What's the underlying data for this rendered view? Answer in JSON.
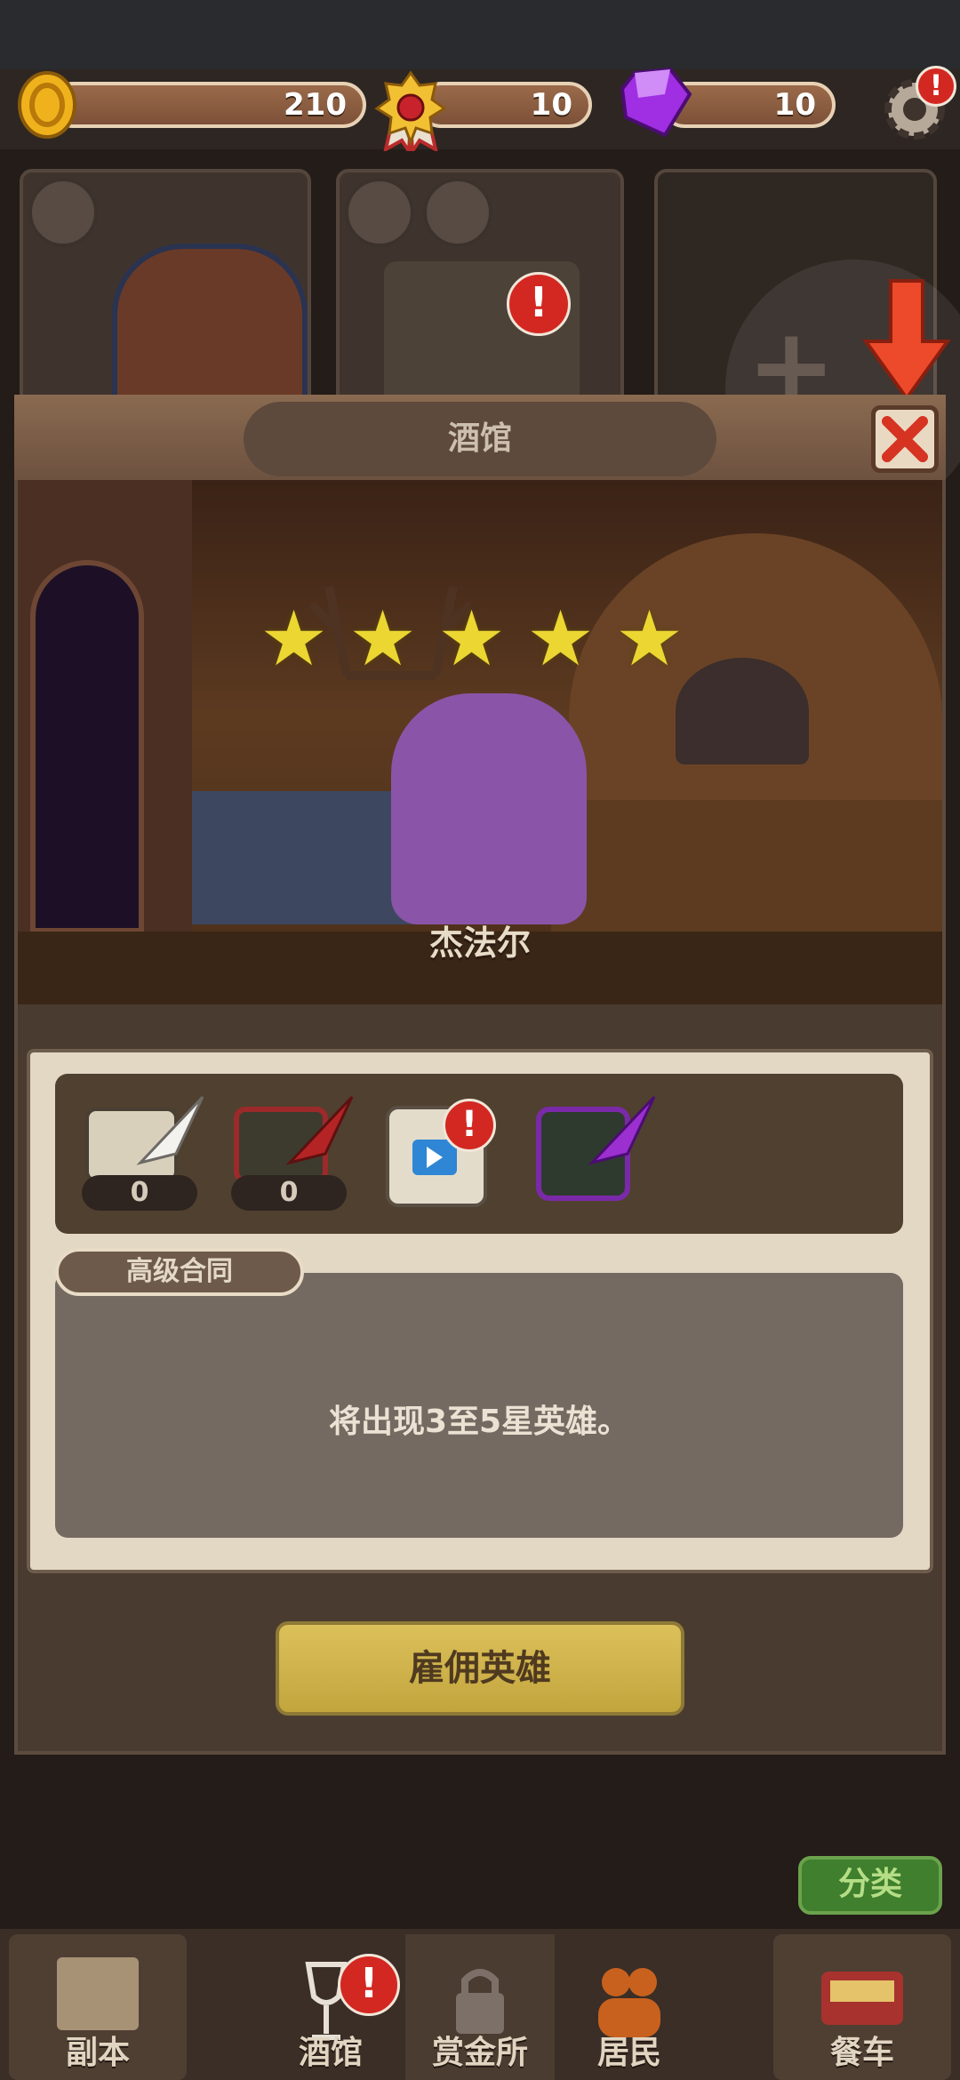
{
  "resources": {
    "gold": "210",
    "medal": "10",
    "gem": "10"
  },
  "dialog": {
    "title": "酒馆",
    "hero_name": "杰法尔",
    "stars": 5
  },
  "scrolls": [
    {
      "name": "white-scroll",
      "count": "0"
    },
    {
      "name": "red-scroll",
      "count": "0"
    },
    {
      "name": "video-scroll",
      "count": ""
    },
    {
      "name": "purple-scroll",
      "count": ""
    }
  ],
  "contract": {
    "tab": "高级合同",
    "description": "将出现3至5星英雄。"
  },
  "hire_button": "雇佣英雄",
  "sort_button": "分类",
  "nav": {
    "dungeon": "副本",
    "tavern": "酒馆",
    "bounty": "赏金所",
    "residents": "居民",
    "food_truck": "餐车"
  },
  "alert_mark": "!",
  "colors": {
    "gold_star": "#ecd632",
    "hire_button": "#cdb04a",
    "alert": "#d32822",
    "sort_button": "#3f7f2d"
  }
}
